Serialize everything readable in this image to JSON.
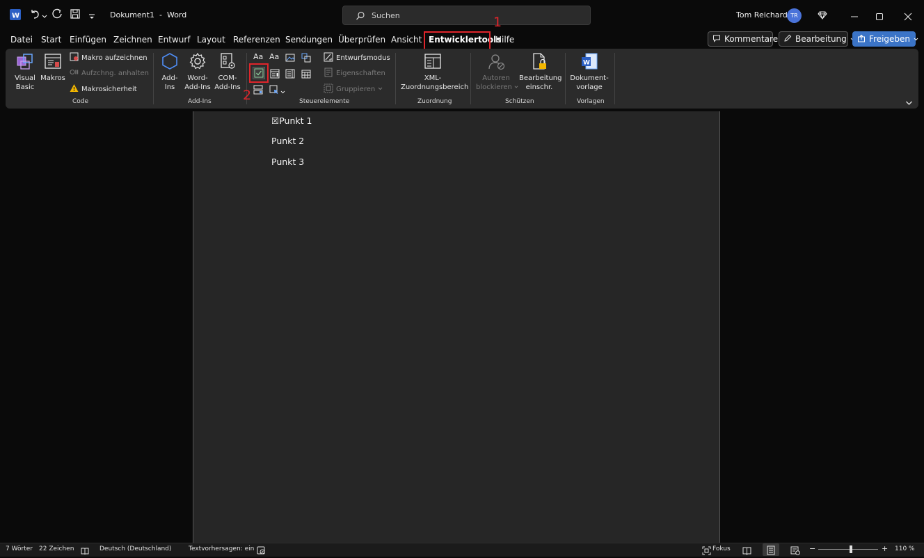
{
  "titlebar": {
    "doc_name": "Dokument1",
    "separator": "-",
    "app_name": "Word",
    "search_placeholder": "Suchen",
    "user_name": "Tom Reichardt",
    "user_initials": "TR"
  },
  "tabs": [
    {
      "label": "Datei"
    },
    {
      "label": "Start"
    },
    {
      "label": "Einfügen"
    },
    {
      "label": "Zeichnen"
    },
    {
      "label": "Entwurf"
    },
    {
      "label": "Layout"
    },
    {
      "label": "Referenzen"
    },
    {
      "label": "Sendungen"
    },
    {
      "label": "Überprüfen"
    },
    {
      "label": "Ansicht"
    },
    {
      "label": "Entwicklertools"
    },
    {
      "label": "Hilfe"
    }
  ],
  "header_buttons": {
    "comments": "Kommentare",
    "editing": "Bearbeitung",
    "share": "Freigeben"
  },
  "ribbon": {
    "code": {
      "label": "Code",
      "visual_basic_1": "Visual",
      "visual_basic_2": "Basic",
      "macros": "Makros",
      "record_macro": "Makro aufzeichnen",
      "pause_recording": "Aufzchng. anhalten",
      "macro_security": "Makrosicherheit"
    },
    "addins": {
      "label": "Add-Ins",
      "addins_1": "Add-",
      "addins_2": "Ins",
      "word_addins_1": "Word-",
      "word_addins_2": "Add-Ins",
      "com_addins_1": "COM-",
      "com_addins_2": "Add-Ins"
    },
    "controls": {
      "label": "Steuerelemente",
      "aa": "Aa",
      "design_mode": "Entwurfsmodus",
      "properties": "Eigenschaften",
      "group": "Gruppieren"
    },
    "mapping": {
      "label": "Zuordnung",
      "xml_1": "XML-",
      "xml_2": "Zuordnungsbereich"
    },
    "protect": {
      "label": "Schützen",
      "block_authors_1": "Autoren",
      "block_authors_2": "blockieren",
      "restrict_1": "Bearbeitung",
      "restrict_2": "einschr."
    },
    "templates": {
      "label": "Vorlagen",
      "doc_template_1": "Dokument-",
      "doc_template_2": "vorlage"
    }
  },
  "document": {
    "lines": [
      {
        "prefix": "☒",
        "text": "Punkt 1"
      },
      {
        "prefix": "",
        "text": "Punkt 2"
      },
      {
        "prefix": "",
        "text": "Punkt 3"
      }
    ]
  },
  "status": {
    "words": "7 Wörter",
    "chars": "22 Zeichen",
    "language": "Deutsch (Deutschland)",
    "predictions": "Textvorhersagen: ein",
    "focus": "Fokus",
    "zoom_minus": "−",
    "zoom_plus": "+",
    "zoom": "110 %",
    "zoom_level_fraction": 0.55
  },
  "annotations": {
    "step1": "1",
    "step2": "2"
  },
  "colors": {
    "accent": "#6ea6ff",
    "share_button": "#3b74c7",
    "annotation": "#e0252b",
    "avatar": "#4a73d9"
  }
}
